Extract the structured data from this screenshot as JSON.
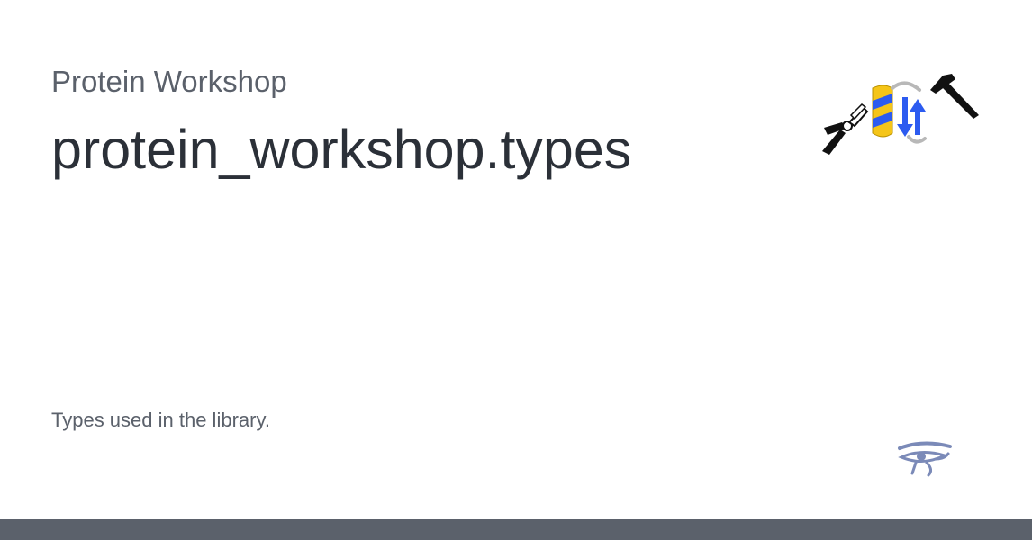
{
  "header": {
    "site_name": "Protein Workshop",
    "page_title": "protein_workshop.types"
  },
  "content": {
    "description": "Types used in the library."
  },
  "logo": {
    "icons": [
      "pliers-icon",
      "protein-helix-icon",
      "protein-strand-arrows-icon",
      "hammer-icon"
    ],
    "colors": {
      "helix_yellow": "#F5C518",
      "strand_blue": "#2C5BF0",
      "loop_gray": "#B8B8B8",
      "tool_black": "#111111"
    }
  },
  "footer": {
    "icon": "eye-of-horus-icon",
    "bar_color": "#5B616B"
  }
}
